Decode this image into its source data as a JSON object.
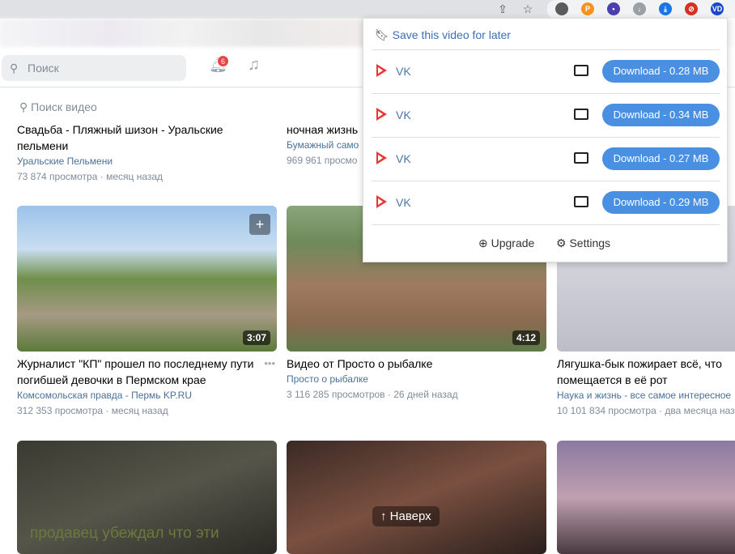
{
  "browser": {
    "icons": [
      "share-icon",
      "star-icon"
    ],
    "extensions": [
      {
        "name": "ext-colorful",
        "color": "#5b5b5b",
        "label": ""
      },
      {
        "name": "ext-p",
        "color": "#f7931e",
        "label": "P"
      },
      {
        "name": "ext-face",
        "color": "#4b3fb0",
        "label": "•"
      },
      {
        "name": "ext-download-circle",
        "color": "#9aa0a6",
        "label": "↓"
      },
      {
        "name": "ext-download",
        "color": "#1a73e8",
        "label": "⤓"
      },
      {
        "name": "ext-block",
        "color": "#d93025",
        "label": "⊘"
      },
      {
        "name": "ext-vd",
        "color": "#1a47c8",
        "label": "VD"
      }
    ]
  },
  "header": {
    "search_placeholder": "Поиск",
    "notifications": "6"
  },
  "video_search_placeholder": "Поиск видео",
  "row1": [
    {
      "title": "Свадьба - Пляжный шизон - Уральские пельмени",
      "channel": "Уральские Пельмени",
      "views": "73 874 просмотра",
      "age": "месяц назад"
    },
    {
      "title": "ночная жизнь",
      "channel": "Бумажный само",
      "views": "969 961 просмо",
      "age": ""
    }
  ],
  "row2": [
    {
      "title": "Журналист \"КП\" прошел по последнему пути погибшей девочки в Пермском крае",
      "channel": "Комсомольская правда - Пермь KP.RU",
      "views": "312 353 просмотра",
      "age": "месяц назад",
      "duration": "3:07"
    },
    {
      "title": "Видео от Просто о рыбалке",
      "channel": "Просто о рыбалке",
      "views": "3 116 285 просмотров",
      "age": "26 дней назад",
      "duration": "4:12"
    },
    {
      "title": "Лягушка-бык пожирает всё, что помещается в её рот",
      "channel": "Наука и жизнь - все самое интересное",
      "views": "10 101 834 просмотра",
      "age": "два месяца назад",
      "duration": ""
    }
  ],
  "row3_overlay": "продавец убеждал что эти",
  "scroll_top": "Наверх",
  "popup": {
    "save": "Save this video for later",
    "items": [
      {
        "source": "VK",
        "button": "Download - 0.28 MB"
      },
      {
        "source": "VK",
        "button": "Download - 0.34 MB"
      },
      {
        "source": "VK",
        "button": "Download - 0.27 MB"
      },
      {
        "source": "VK",
        "button": "Download - 0.29 MB"
      }
    ],
    "upgrade": "Upgrade",
    "settings": "Settings"
  }
}
